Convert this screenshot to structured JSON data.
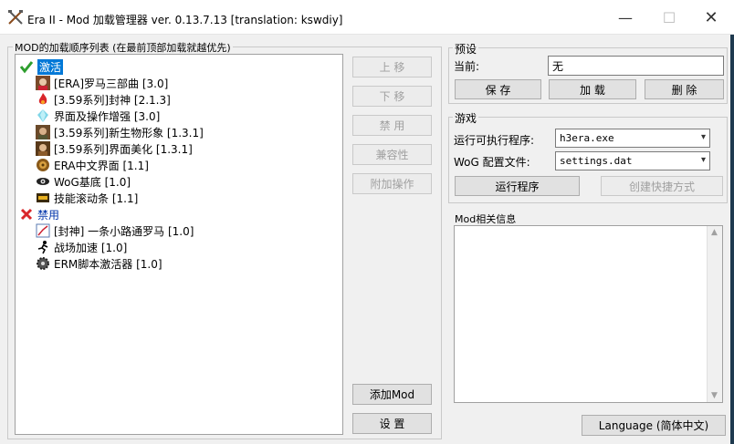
{
  "window": {
    "title": "Era II - Mod 加载管理器 ver. 0.13.7.13 [translation: kswdiy]",
    "min_glyph": "—",
    "max_glyph": "☐",
    "close_glyph": "✕"
  },
  "mod_list": {
    "group_label": "MOD的加载顺序列表 (在最前顶部加载就越优先)",
    "active_header": "激活",
    "disabled_header": "禁用",
    "active_items": [
      {
        "label": "[ERA]罗马三部曲 [3.0]",
        "icon": "rome-portrait-icon"
      },
      {
        "label": "[3.59系列]封神 [2.1.3]",
        "icon": "red-flame-icon"
      },
      {
        "label": "界面及操作增强 [3.0]",
        "icon": "crystal-icon"
      },
      {
        "label": "[3.59系列]新生物形象 [1.3.1]",
        "icon": "creature-portrait-icon"
      },
      {
        "label": "[3.59系列]界面美化 [1.3.1]",
        "icon": "interface-portrait-icon"
      },
      {
        "label": "ERA中文界面 [1.1]",
        "icon": "bronze-shield-icon"
      },
      {
        "label": "WoG基底 [1.0]",
        "icon": "wog-eye-icon"
      },
      {
        "label": "技能滚动条 [1.1]",
        "icon": "scroll-bar-icon"
      }
    ],
    "disabled_items": [
      {
        "label": "[封神] 一条小路通罗马 [1.0]",
        "icon": "road-map-icon"
      },
      {
        "label": "战场加速 [1.0]",
        "icon": "running-man-icon"
      },
      {
        "label": "ERM脚本激活器 [1.0]",
        "icon": "gear-icon"
      }
    ]
  },
  "side_buttons": {
    "move_up": "上 移",
    "move_down": "下 移",
    "disable": "禁 用",
    "compat": "兼容性",
    "extra": "附加操作",
    "add_mod": "添加Mod",
    "settings": "设 置"
  },
  "preset": {
    "label": "预设",
    "current_label": "当前:",
    "current_value": "无",
    "save": "保 存",
    "load": "加 载",
    "delete": "删 除"
  },
  "game": {
    "label": "游戏",
    "exe_label": "运行可执行程序:",
    "exe_value": "h3era.exe",
    "cfg_label": "WoG 配置文件:",
    "cfg_value": "settings.dat",
    "run": "运行程序",
    "shortcut": "创建快捷方式"
  },
  "info": {
    "label": "Mod相关信息"
  },
  "language_button": "Language (简体中文)",
  "colors": {
    "accent": "#0078d7",
    "check": "#2e9e2e",
    "cross": "#d9262a"
  }
}
